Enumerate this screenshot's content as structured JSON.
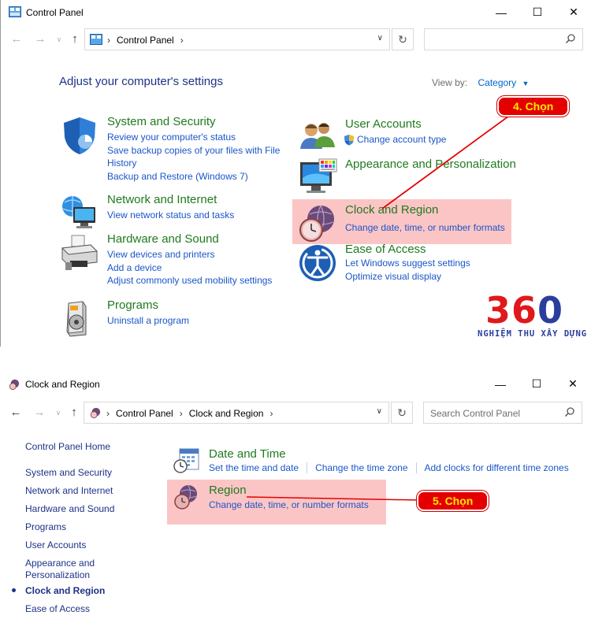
{
  "window1": {
    "title": "Control Panel",
    "address": {
      "crumbs": [
        "Control Panel"
      ]
    },
    "search": {
      "placeholder": ""
    },
    "heading": "Adjust your computer's settings",
    "view_by": {
      "label": "View by:",
      "value": "Category"
    },
    "categories_left": [
      {
        "title": "System and Security",
        "links": [
          "Review your computer's status",
          "Save backup copies of your files with File",
          "History",
          "Backup and Restore (Windows 7)"
        ],
        "icon": "shield-icon"
      },
      {
        "title": "Network and Internet",
        "links": [
          "View network status and tasks"
        ],
        "icon": "network-globe-icon"
      },
      {
        "title": "Hardware and Sound",
        "links": [
          "View devices and printers",
          "Add a device",
          "Adjust commonly used mobility settings"
        ],
        "icon": "printer-icon"
      },
      {
        "title": "Programs",
        "links": [
          "Uninstall a program"
        ],
        "icon": "programs-icon"
      }
    ],
    "categories_right": [
      {
        "title": "User Accounts",
        "links": [
          "Change account type"
        ],
        "icon": "users-icon"
      },
      {
        "title": "Appearance and Personalization",
        "links": [],
        "icon": "monitor-icon"
      },
      {
        "title": "Clock and Region",
        "links": [
          "Change date, time, or number formats"
        ],
        "icon": "clock-globe-icon"
      },
      {
        "title": "Ease of Access",
        "links": [
          "Let Windows suggest settings",
          "Optimize visual display"
        ],
        "icon": "ease-access-icon"
      }
    ],
    "callout": "4. Chọn",
    "logo": {
      "digits": "360",
      "tagline": "NGHIỆM THU XÂY DỰNG"
    }
  },
  "window2": {
    "title": "Clock and Region",
    "address": {
      "crumbs": [
        "Control Panel",
        "Clock and Region"
      ]
    },
    "search": {
      "placeholder": "Search Control Panel"
    },
    "sidebar": {
      "home": "Control Panel Home",
      "items": [
        "System and Security",
        "Network and Internet",
        "Hardware and Sound",
        "Programs",
        "User Accounts",
        "Appearance and",
        "Personalization",
        "Clock and Region",
        "Ease of Access"
      ]
    },
    "sections": [
      {
        "title": "Date and Time",
        "links": [
          "Set the time and date",
          "Change the time zone",
          "Add clocks for different time zones"
        ]
      },
      {
        "title": "Region",
        "links": [
          "Change date, time, or number formats"
        ]
      }
    ],
    "callout": "5. Chọn"
  },
  "colors": {
    "highlight": "#fcc5c5",
    "callout_bg": "#e40000",
    "callout_text": "#ffe900",
    "link": "#1a56c9",
    "category_title": "#1f7a1f"
  }
}
